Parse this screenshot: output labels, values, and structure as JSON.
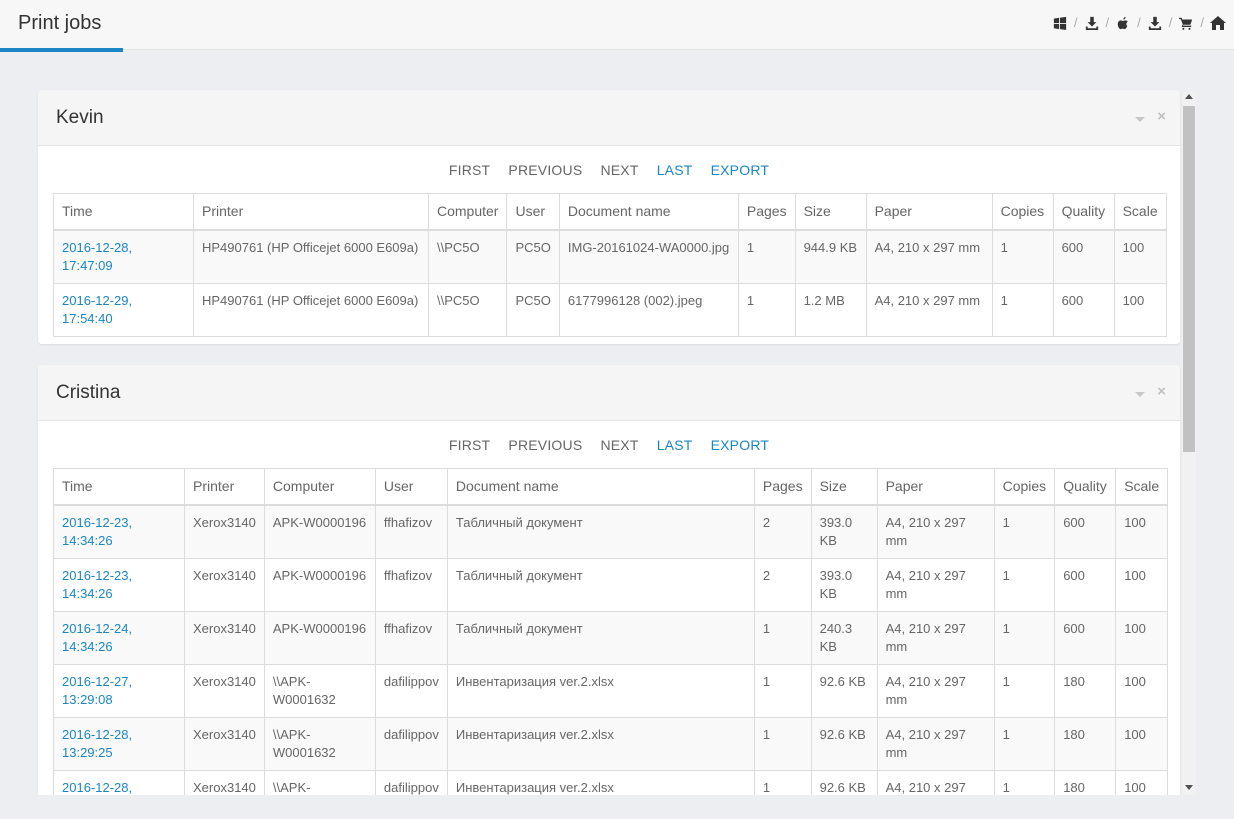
{
  "header": {
    "title": "Print jobs",
    "icons": [
      "windows-icon",
      "download-icon",
      "apple-icon",
      "download-icon",
      "cart-icon",
      "home-icon"
    ],
    "separator": "/"
  },
  "pager": {
    "first": "FIRST",
    "previous": "PREVIOUS",
    "next": "NEXT",
    "last": "LAST",
    "export": "EXPORT"
  },
  "panels": [
    {
      "name": "Kevin",
      "columns": [
        "Time",
        "Printer",
        "Computer",
        "User",
        "Document name",
        "Pages",
        "Size",
        "Paper",
        "Copies",
        "Quality",
        "Scale"
      ],
      "rows": [
        [
          "2016-12-28, 17:47:09",
          "HP490761 (HP Officejet 6000 E609a)",
          "\\\\PC5O",
          "PC5O",
          "IMG-20161024-WA0000.jpg",
          "1",
          "944.9 KB",
          "A4, 210 x 297 mm",
          "1",
          "600",
          "100"
        ],
        [
          "2016-12-29, 17:54:40",
          "HP490761 (HP Officejet 6000 E609a)",
          "\\\\PC5O",
          "PC5O",
          "6177996128 (002).jpeg",
          "1",
          "1.2 MB",
          "A4, 210 x 297 mm",
          "1",
          "600",
          "100"
        ]
      ]
    },
    {
      "name": "Cristina",
      "columns": [
        "Time",
        "Printer",
        "Computer",
        "User",
        "Document name",
        "Pages",
        "Size",
        "Paper",
        "Copies",
        "Quality",
        "Scale"
      ],
      "rows": [
        [
          "2016-12-23, 14:34:26",
          "Xerox3140",
          "APK-W0000196",
          "ffhafizov",
          "Табличный документ",
          "2",
          "393.0 KB",
          "A4, 210 x 297 mm",
          "1",
          "600",
          "100"
        ],
        [
          "2016-12-23, 14:34:26",
          "Xerox3140",
          "APK-W0000196",
          "ffhafizov",
          "Табличный документ",
          "2",
          "393.0 KB",
          "A4, 210 x 297 mm",
          "1",
          "600",
          "100"
        ],
        [
          "2016-12-24, 14:34:26",
          "Xerox3140",
          "APK-W0000196",
          "ffhafizov",
          "Табличный документ",
          "1",
          "240.3 KB",
          "A4, 210 x 297 mm",
          "1",
          "600",
          "100"
        ],
        [
          "2016-12-27, 13:29:08",
          "Xerox3140",
          "\\\\APK-W0001632",
          "dafilippov",
          "Инвентаризация ver.2.xlsx",
          "1",
          "92.6 KB",
          "A4, 210 x 297 mm",
          "1",
          "180",
          "100"
        ],
        [
          "2016-12-28, 13:29:25",
          "Xerox3140",
          "\\\\APK-W0001632",
          "dafilippov",
          "Инвентаризация ver.2.xlsx",
          "1",
          "92.6 KB",
          "A4, 210 x 297 mm",
          "1",
          "180",
          "100"
        ],
        [
          "2016-12-28,",
          "Xerox3140",
          "\\\\APK-",
          "dafilippov",
          "Инвентаризация ver.2.xlsx",
          "1",
          "92.6 KB",
          "A4, 210 x 297",
          "1",
          "180",
          "100"
        ]
      ]
    }
  ]
}
